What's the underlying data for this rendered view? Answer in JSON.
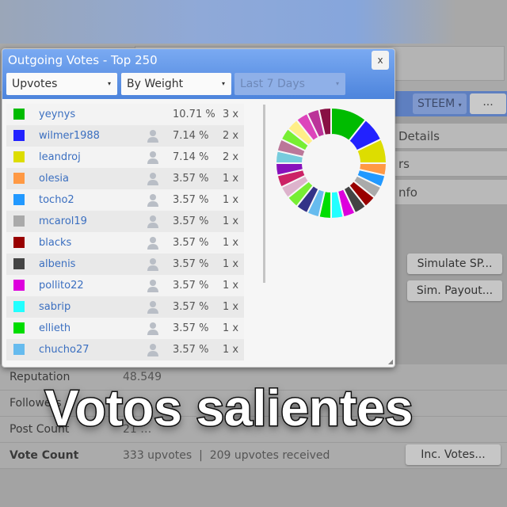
{
  "background": {
    "currency_select": "STEEM",
    "more_button": "...",
    "menu_items": [
      "Details",
      "rs",
      "nfo"
    ],
    "buttons": {
      "simulate_sp": "Simulate SP...",
      "sim_payout": "Sim. Payout...",
      "inc_votes": "Inc. Votes..."
    },
    "table": [
      {
        "label": "Reputation",
        "value": "48.549"
      },
      {
        "label": "Followers",
        "value": ""
      },
      {
        "label": "Post Count",
        "value": "21 …"
      },
      {
        "label": "Vote Count",
        "value": "333 upvotes  |  209 upvotes received"
      }
    ]
  },
  "dialog": {
    "title": "Outgoing Votes - Top 250",
    "close_label": "x",
    "filters": {
      "type": "Upvotes",
      "sort": "By Weight",
      "period": "Last 7 Days"
    },
    "rows": [
      {
        "name": "yeynys",
        "percent": "10.71 %",
        "count": "3 x",
        "color": "#00bb00",
        "user_icon": false
      },
      {
        "name": "wilmer1988",
        "percent": "7.14 %",
        "count": "2 x",
        "color": "#2222ff",
        "user_icon": true
      },
      {
        "name": "leandroj",
        "percent": "7.14 %",
        "count": "2 x",
        "color": "#dddd00",
        "user_icon": true
      },
      {
        "name": "olesia",
        "percent": "3.57 %",
        "count": "1 x",
        "color": "#ff9944",
        "user_icon": true
      },
      {
        "name": "tocho2",
        "percent": "3.57 %",
        "count": "1 x",
        "color": "#2299ff",
        "user_icon": true
      },
      {
        "name": "mcarol19",
        "percent": "3.57 %",
        "count": "1 x",
        "color": "#aaaaaa",
        "user_icon": true
      },
      {
        "name": "blacks",
        "percent": "3.57 %",
        "count": "1 x",
        "color": "#990000",
        "user_icon": true
      },
      {
        "name": "albenis",
        "percent": "3.57 %",
        "count": "1 x",
        "color": "#444444",
        "user_icon": true
      },
      {
        "name": "pollito22",
        "percent": "3.57 %",
        "count": "1 x",
        "color": "#dd00dd",
        "user_icon": true
      },
      {
        "name": "sabrip",
        "percent": "3.57 %",
        "count": "1 x",
        "color": "#22ffff",
        "user_icon": true
      },
      {
        "name": "ellieth",
        "percent": "3.57 %",
        "count": "1 x",
        "color": "#00dd00",
        "user_icon": true
      },
      {
        "name": "chucho27",
        "percent": "3.57 %",
        "count": "1 x",
        "color": "#66bbee",
        "user_icon": true
      }
    ]
  },
  "chart_data": {
    "type": "pie",
    "donut": true,
    "values": [
      10.71,
      7.14,
      7.14,
      3.57,
      3.57,
      3.57,
      3.57,
      3.57,
      3.57,
      3.57,
      3.57,
      3.57,
      3.57,
      3.57,
      3.57,
      3.57,
      3.57,
      3.57,
      3.57,
      3.57,
      3.57,
      3.57,
      3.57,
      3.57
    ],
    "colors": [
      "#00bb00",
      "#2222ff",
      "#dddd00",
      "#ff9944",
      "#2299ff",
      "#aaaaaa",
      "#990000",
      "#444444",
      "#dd00dd",
      "#22ffff",
      "#00dd00",
      "#66bbee",
      "#333388",
      "#77ee33",
      "#ddb3cc",
      "#cc2266",
      "#8811bb",
      "#77ccdd",
      "#bb7799",
      "#77ee33",
      "#ffee88",
      "#dd44bb",
      "#bb3399",
      "#881144"
    ]
  },
  "caption": "Votos salientes"
}
